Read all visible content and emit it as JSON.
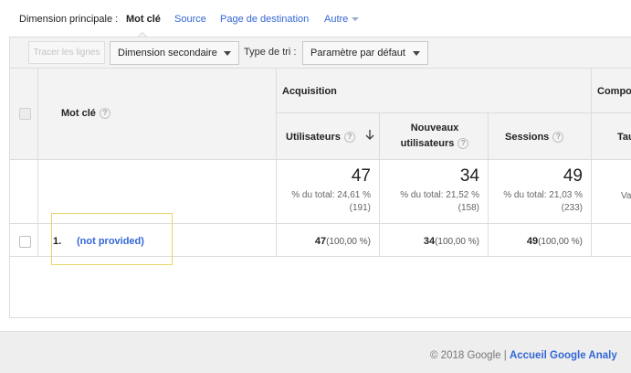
{
  "dimension_bar": {
    "label": "Dimension principale :",
    "options": [
      {
        "label": "Mot clé",
        "active": true
      },
      {
        "label": "Source",
        "active": false
      },
      {
        "label": "Page de destination",
        "active": false
      },
      {
        "label": "Autre",
        "active": false
      }
    ]
  },
  "controls": {
    "plot_rows": "Tracer les lignes",
    "secondary_dimension": "Dimension secondaire",
    "sort_type_label": "Type de tri :",
    "sort_type_value": "Paramètre par défaut"
  },
  "table": {
    "dimension_header": "Mot clé",
    "help_glyph": "?",
    "group_acquisition": "Acquisition",
    "group_behavior": "Compor",
    "columns": [
      {
        "label": "Utilisateurs",
        "sorted": true
      },
      {
        "label_line1": "Nouveaux",
        "label_line2": "utilisateurs"
      },
      {
        "label": "Sessions"
      },
      {
        "label": "Tau"
      }
    ],
    "totals": [
      {
        "value": "47",
        "pct": "% du total: 24,61 %",
        "of": "(191)"
      },
      {
        "value": "34",
        "pct": "% du total: 21,52 %",
        "of": "(158)"
      },
      {
        "value": "49",
        "pct": "% du total: 21,03 %",
        "of": "(233)"
      },
      {
        "value": "Va"
      }
    ],
    "rows": [
      {
        "index": "1.",
        "keyword": "(not provided)",
        "values": [
          {
            "v": "47",
            "p": "(100,00 %)"
          },
          {
            "v": "34",
            "p": "(100,00 %)"
          },
          {
            "v": "49",
            "p": "(100,00 %)"
          }
        ]
      }
    ]
  },
  "footer": {
    "copyright": "© 2018 Google",
    "separator": "|",
    "link": "Accueil Google Analy"
  }
}
